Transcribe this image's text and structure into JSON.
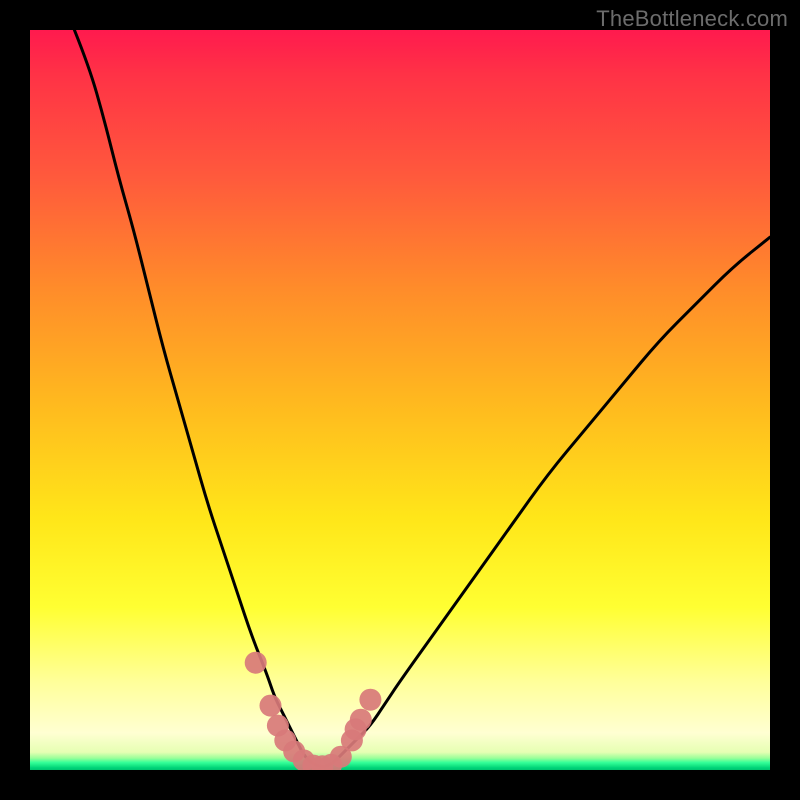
{
  "watermark": "TheBottleneck.com",
  "colors": {
    "background": "#000000",
    "curve_stroke": "#000000",
    "marker_fill": "#d87a7a",
    "gradient_stops": [
      "#ff1a4e",
      "#ff5a3c",
      "#ffb81f",
      "#ffff32",
      "#ffffd2",
      "#33ff99",
      "#00c46f"
    ]
  },
  "chart_data": {
    "type": "line",
    "title": "",
    "xlabel": "",
    "ylabel": "",
    "xlim": [
      0,
      100
    ],
    "ylim": [
      0,
      100
    ],
    "grid": false,
    "curve_note": "V-shaped bottleneck curve; left arm steep from top-left to minimum near x≈37, right arm rises with slower slope to upper-right. Values are percentages read from pixel geometry.",
    "x": [
      6,
      8,
      10,
      12,
      14,
      16,
      18,
      20,
      22,
      24,
      26,
      28,
      30,
      32,
      33,
      34,
      35,
      36,
      37,
      38,
      39,
      40,
      41,
      42,
      44,
      46,
      48,
      50,
      55,
      60,
      65,
      70,
      75,
      80,
      85,
      90,
      95,
      100
    ],
    "y": [
      100,
      95,
      88,
      80,
      73,
      65,
      57,
      50,
      43,
      36,
      30,
      24,
      18,
      13,
      10,
      8,
      6,
      4,
      2,
      1,
      0.5,
      0.5,
      1,
      2,
      4,
      6,
      9,
      12,
      19,
      26,
      33,
      40,
      46,
      52,
      58,
      63,
      68,
      72
    ],
    "markers_note": "Apparent dot markers clustered near the bottom of the V; positions are (x, y) percentage estimates.",
    "markers": [
      {
        "x": 30.5,
        "y": 14.5
      },
      {
        "x": 32.5,
        "y": 8.7
      },
      {
        "x": 33.5,
        "y": 6.0
      },
      {
        "x": 34.5,
        "y": 4.0
      },
      {
        "x": 35.7,
        "y": 2.5
      },
      {
        "x": 37.0,
        "y": 1.3
      },
      {
        "x": 38.3,
        "y": 0.6
      },
      {
        "x": 39.5,
        "y": 0.5
      },
      {
        "x": 40.7,
        "y": 0.7
      },
      {
        "x": 42.0,
        "y": 1.8
      },
      {
        "x": 43.5,
        "y": 4.0
      },
      {
        "x": 44.0,
        "y": 5.5
      },
      {
        "x": 44.7,
        "y": 6.8
      },
      {
        "x": 46.0,
        "y": 9.5
      }
    ]
  }
}
